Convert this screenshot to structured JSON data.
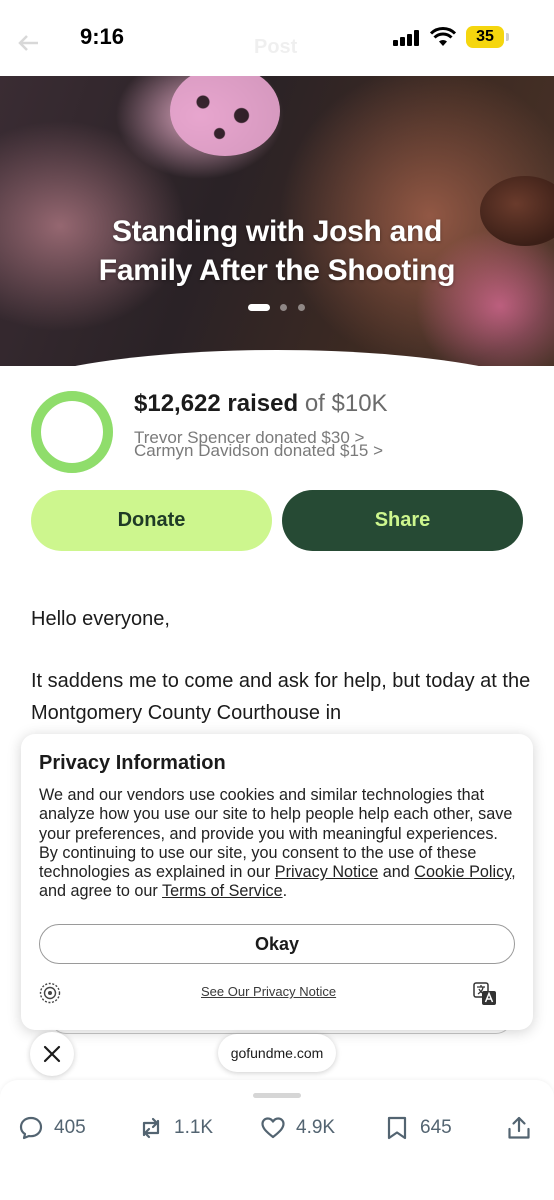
{
  "status_bar": {
    "time": "9:16",
    "battery": "35",
    "background_title": "Post"
  },
  "hero": {
    "title_line1": "Standing with Josh and",
    "title_line2": "Family After the Shooting",
    "slide_count": 3,
    "active_slide": 1
  },
  "fundraiser": {
    "raised_amount": "$12,622 raised",
    "goal": "of $10K",
    "progress_fraction": 1.0,
    "recent_donations": [
      "Trevor Spencer donated $30 >",
      "Carmyn Davidson donated $15 >"
    ],
    "donate_label": "Donate",
    "share_label": "Share"
  },
  "story": {
    "greeting": "Hello everyone,",
    "paragraph_1": "It saddens me to come and ask for help, but today at the Montgomery County Courthouse in"
  },
  "privacy_modal": {
    "title": "Privacy Information",
    "body_text": "We and our vendors use cookies and similar technologies that analyze how you use our site to help people help each other, save your preferences, and provide you with meaningful experiences. By continuing to use our site, you consent to the use of these technologies as explained in our",
    "privacy_notice_link": "Privacy Notice",
    "and_text": "and",
    "cookie_policy_link": "Cookie Policy",
    "agree_text": ", and agree to our",
    "terms_link": "Terms of Service",
    "period": ".",
    "okay_label": "Okay",
    "see_notice_link": "See Our Privacy Notice"
  },
  "browser": {
    "domain": "gofundme.com"
  },
  "engagement": {
    "replies": "405",
    "reposts": "1.1K",
    "likes": "4.9K",
    "bookmarks": "645"
  },
  "colors": {
    "accent_light_green": "#cdf68e",
    "accent_dark_green": "#264a34",
    "ring_green": "#8fdd6b",
    "battery_yellow": "#f5d60e",
    "action_gray": "#536471"
  },
  "icons": [
    "back-arrow-icon",
    "signal-icon",
    "wifi-icon",
    "battery-icon",
    "close-icon",
    "shield-icon",
    "translate-icon",
    "reply-icon",
    "repost-icon",
    "like-icon",
    "bookmark-icon",
    "share-icon"
  ]
}
